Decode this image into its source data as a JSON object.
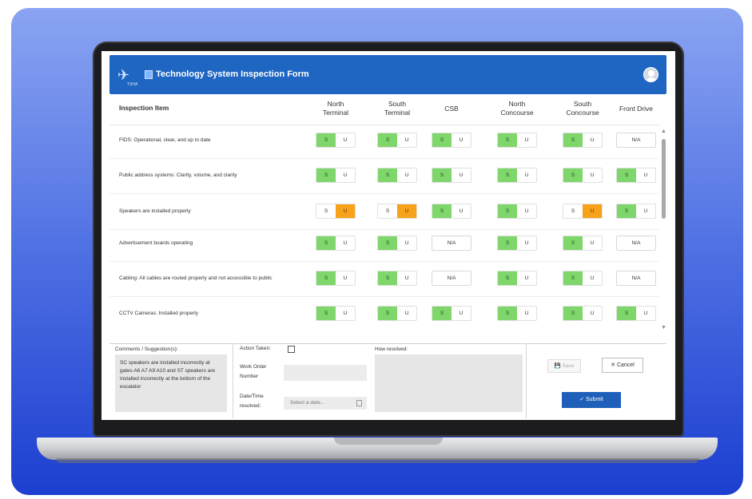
{
  "app": {
    "title": "Technology System Inspection Form",
    "logo_sub": "TSHA"
  },
  "columns": {
    "item": "Inspection Item",
    "terminals": [
      [
        "North",
        "Terminal"
      ],
      [
        "South",
        "Terminal"
      ],
      [
        "CSB",
        ""
      ],
      [
        "North",
        "Concourse"
      ],
      [
        "South",
        "Concourse"
      ],
      [
        "Front Drive",
        ""
      ]
    ]
  },
  "toggle_labels": {
    "s": "S",
    "u": "U",
    "na": "N/A"
  },
  "rows": [
    {
      "label": "FIDS: Operational, clear, and up to date",
      "values": [
        "S",
        "S",
        "S",
        "S",
        "S",
        "NA"
      ]
    },
    {
      "label": "Public address systems:  Clarity, volume, and clarity",
      "values": [
        "S",
        "S",
        "S",
        "S",
        "S",
        "S"
      ]
    },
    {
      "label": "Speakers are installed properly",
      "values": [
        "U",
        "U",
        "S",
        "S",
        "U",
        "S"
      ]
    },
    {
      "label": "Advertisement boards operating",
      "values": [
        "S",
        "S",
        "NA",
        "S",
        "S",
        "NA"
      ]
    },
    {
      "label": "Cabling:  All cables are routed properly and not  accessible to public",
      "values": [
        "S",
        "S",
        "NA",
        "S",
        "S",
        "NA"
      ]
    },
    {
      "label": "CCTV Cameras:  Installed properly",
      "values": [
        "S",
        "S",
        "S",
        "S",
        "S",
        "S"
      ]
    }
  ],
  "bottom": {
    "comments_label": "Comments / Suggestion(s):",
    "comments_text": "SC speakers are installed incorrectly at gates A6 A7 A9 A10 and ST speakers are installed incorrectly at the bottom of the escalator",
    "action_taken_label": "Action Taken:",
    "work_order_label_1": "Work Order",
    "work_order_label_2": "Number",
    "date_label_1": "Date/Time",
    "date_label_2": "resolved:",
    "date_placeholder": "Select a date...",
    "how_resolved_label": "How resolved:",
    "save_label": "Save",
    "cancel_label": "Cancel",
    "submit_label": "Submit"
  },
  "colors": {
    "header": "#1e66c2",
    "satisfactory": "#7fd76b",
    "unsatisfactory": "#f6a21a",
    "submit": "#1e5fb9"
  }
}
